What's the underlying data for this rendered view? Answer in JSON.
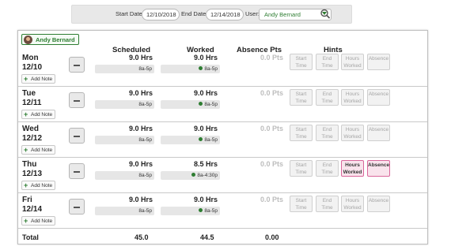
{
  "filter": {
    "start_label": "Start Date:",
    "start_value": "12/10/2018",
    "end_label": "End Date:",
    "end_value": "12/14/2018",
    "user_label": "User:",
    "user_value": "Andy Bernard",
    "search_icon": "search-icon"
  },
  "employee": {
    "name": "Andy Bernard",
    "avatar_icon": "avatar"
  },
  "headers": {
    "scheduled": "Scheduled",
    "worked": "Worked",
    "absence": "Absence Pts",
    "hints": "Hints"
  },
  "add_note_label": "Add Note",
  "hint_labels": [
    "Start\nTime",
    "End\nTime",
    "Hours\nWorked",
    "Absence"
  ],
  "rows": [
    {
      "day": "Mon",
      "date": "12/10",
      "sched_hrs": "9.0 Hrs",
      "sched_range": "8a-5p",
      "worked_hrs": "9.0 Hrs",
      "worked_range": "8a-5p",
      "pts": "0.0 Pts",
      "hints_active": [
        false,
        false,
        false,
        false
      ]
    },
    {
      "day": "Tue",
      "date": "12/11",
      "sched_hrs": "9.0 Hrs",
      "sched_range": "8a-5p",
      "worked_hrs": "9.0 Hrs",
      "worked_range": "8a-5p",
      "pts": "0.0 Pts",
      "hints_active": [
        false,
        false,
        false,
        false
      ]
    },
    {
      "day": "Wed",
      "date": "12/12",
      "sched_hrs": "9.0 Hrs",
      "sched_range": "8a-5p",
      "worked_hrs": "9.0 Hrs",
      "worked_range": "8a-5p",
      "pts": "0.0 Pts",
      "hints_active": [
        false,
        false,
        false,
        false
      ]
    },
    {
      "day": "Thu",
      "date": "12/13",
      "sched_hrs": "9.0 Hrs",
      "sched_range": "8a-5p",
      "worked_hrs": "8.5 Hrs",
      "worked_range": "8a-4:30p",
      "pts": "0.0 Pts",
      "hints_active": [
        false,
        false,
        true,
        true
      ]
    },
    {
      "day": "Fri",
      "date": "12/14",
      "sched_hrs": "9.0 Hrs",
      "sched_range": "8a-5p",
      "worked_hrs": "9.0 Hrs",
      "worked_range": "8a-5p",
      "pts": "0.0 Pts",
      "hints_active": [
        false,
        false,
        false,
        false
      ]
    }
  ],
  "totals": {
    "label": "Total",
    "scheduled": "45.0",
    "worked": "44.5",
    "absence": "0.00"
  },
  "colors": {
    "accent_green": "#2e7d32",
    "hint_active_bg": "#f9e3ec",
    "hint_active_border": "#d9669b"
  }
}
